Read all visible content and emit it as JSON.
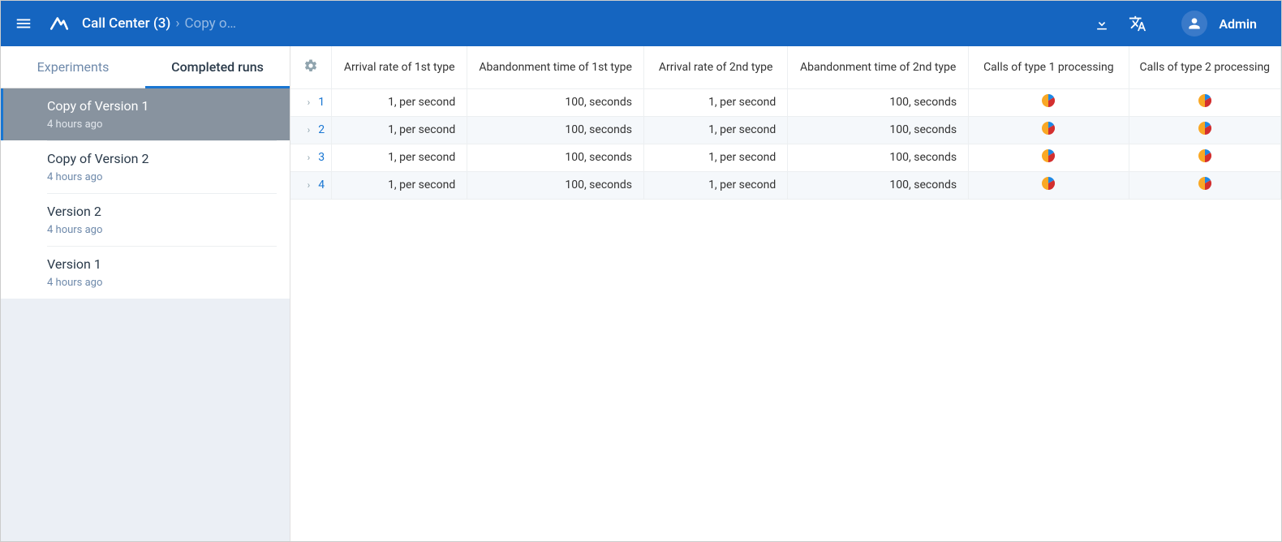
{
  "header": {
    "breadcrumb_main": "Call Center (3)",
    "breadcrumb_sep": "›",
    "breadcrumb_sub": "Copy o…",
    "user_name": "Admin"
  },
  "tabs": {
    "experiments": "Experiments",
    "completed_runs": "Completed runs"
  },
  "runs": [
    {
      "title": "Copy of Version 1",
      "time": "4 hours ago",
      "selected": true
    },
    {
      "title": "Copy of Version 2",
      "time": "4 hours ago",
      "selected": false
    },
    {
      "title": "Version 2",
      "time": "4 hours ago",
      "selected": false
    },
    {
      "title": "Version 1",
      "time": "4 hours ago",
      "selected": false
    }
  ],
  "columns": {
    "arrival1": "Arrival rate of 1st type",
    "aband1": "Abandonment time of 1st type",
    "arrival2": "Arrival rate of 2nd type",
    "aband2": "Abandonment time of 2nd type",
    "proc1": "Calls of type 1 processing",
    "proc2": "Calls of type 2 processing"
  },
  "rows": [
    {
      "idx": "1",
      "arrival1": "1, per second",
      "aband1": "100, seconds",
      "arrival2": "1, per second",
      "aband2": "100, seconds"
    },
    {
      "idx": "2",
      "arrival1": "1, per second",
      "aband1": "100, seconds",
      "arrival2": "1, per second",
      "aband2": "100, seconds"
    },
    {
      "idx": "3",
      "arrival1": "1, per second",
      "aband1": "100, seconds",
      "arrival2": "1, per second",
      "aband2": "100, seconds"
    },
    {
      "idx": "4",
      "arrival1": "1, per second",
      "aband1": "100, seconds",
      "arrival2": "1, per second",
      "aband2": "100, seconds"
    }
  ]
}
